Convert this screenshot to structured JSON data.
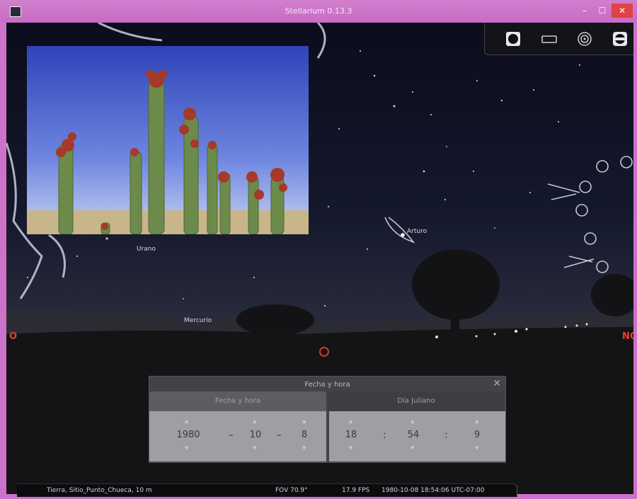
{
  "window": {
    "title": "Stellarium 0.13.3"
  },
  "toolbar": {
    "icons": [
      "full-moon-icon",
      "rectangle-icon",
      "target-icon",
      "planet-icon"
    ]
  },
  "sky_labels": {
    "urano": "Urano",
    "arturo": "Arturo",
    "mercurio": "Mercurio"
  },
  "cardinals": {
    "oeste": "O",
    "sur": "O",
    "noroeste": "NO"
  },
  "dialog": {
    "title": "Fecha y hora",
    "tab_date": "Fecha y hora",
    "tab_julian": "Día Juliano",
    "year": "1980",
    "month": "10",
    "day": "8",
    "hour": "18",
    "minute": "54",
    "second": "9",
    "date_sep": "–",
    "time_sep": ":"
  },
  "status": {
    "location": "Tierra, Sitio_Punto_Chueca, 10 m",
    "fov": "FOV 70.9°",
    "fps": "17.9 FPS",
    "datetime": "1980-10-08 18:54:06 UTC-07:00"
  },
  "colors": {
    "titlebar": "#cc72c9",
    "close": "#e04343",
    "cardinal": "#e1412e"
  }
}
